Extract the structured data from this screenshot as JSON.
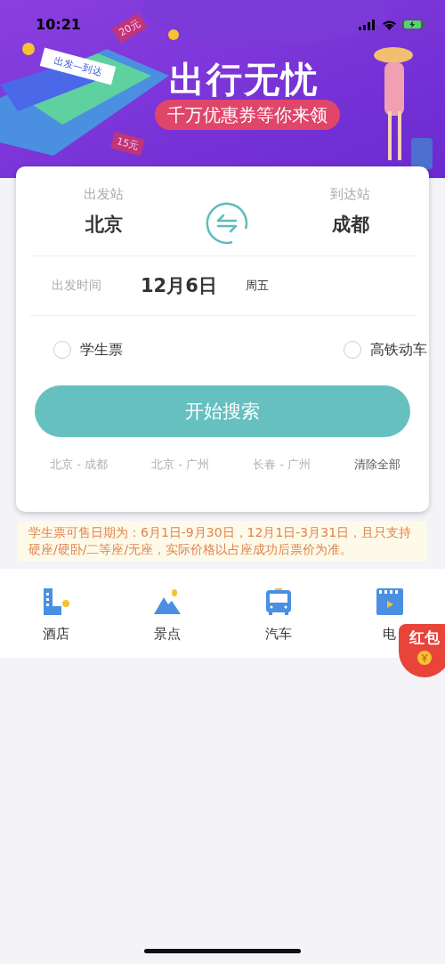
{
  "status_bar": {
    "time": "10:21"
  },
  "banner": {
    "title": "出行无忧",
    "subtitle": "千万优惠券等你来领",
    "ticket": "出发—到达",
    "coupons": [
      "20元",
      "15元"
    ]
  },
  "route": {
    "from_label": "出发站",
    "from": "北京",
    "to_label": "到达站",
    "to": "成都"
  },
  "date": {
    "label": "出发时间",
    "value": "12月6日",
    "weekday": "周五"
  },
  "options": [
    {
      "label": "学生票",
      "checked": false
    },
    {
      "label": "高铁动车",
      "checked": false
    }
  ],
  "search_button": "开始搜索",
  "history": [
    "北京 - 成都",
    "北京 - 广州",
    "长春 - 广州"
  ],
  "clear_history": "清除全部",
  "notice": "学生票可售日期为：6月1日-9月30日，12月1日-3月31日，且只支持硬座/硬卧/二等座/无座，实际价格以占座成功后票价为准。",
  "services": [
    {
      "kind": "hotel",
      "label": "酒店"
    },
    {
      "kind": "scenery",
      "label": "景点"
    },
    {
      "kind": "bus",
      "label": "汽车"
    },
    {
      "kind": "movie",
      "label": "电"
    }
  ],
  "red_packet": "红包"
}
